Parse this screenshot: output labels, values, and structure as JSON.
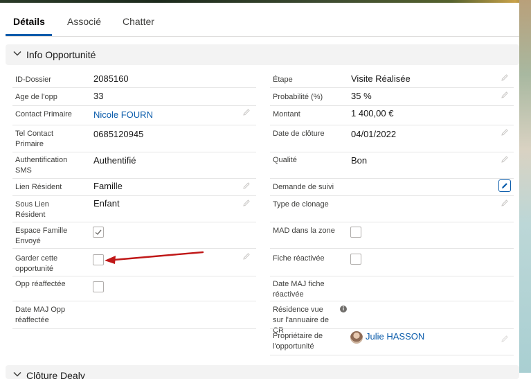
{
  "tabs": [
    {
      "label": "Détails",
      "active": true
    },
    {
      "label": "Associé"
    },
    {
      "label": "Chatter"
    }
  ],
  "section": {
    "title": "Info Opportunité"
  },
  "section2": {
    "title": "Clôture Dealy"
  },
  "left_fields": [
    {
      "label": "ID-Dossier",
      "value": "2085160"
    },
    {
      "label": "Age de l'opp",
      "value": "33"
    },
    {
      "label": "Contact Primaire",
      "value": "Nicole FOURN"
    },
    {
      "label": "Tel Contact Primaire",
      "value": "0685120945"
    },
    {
      "label": "Authentification SMS",
      "value": "Authentifié"
    },
    {
      "label": "Lien Résident",
      "value": "Famille"
    },
    {
      "label": "Sous Lien Résident",
      "value": "Enfant"
    },
    {
      "label": "Espace Famille Envoyé",
      "value": ""
    },
    {
      "label": "Garder cette opportunité",
      "value": ""
    },
    {
      "label": "Opp réaffectée",
      "value": ""
    },
    {
      "label": "Date MAJ Opp réaffectée",
      "value": ""
    }
  ],
  "right_fields": [
    {
      "label": "Étape",
      "value": "Visite Réalisée"
    },
    {
      "label": "Probabilité (%)",
      "value": "35 %"
    },
    {
      "label": "Montant",
      "value": "1 400,00 €"
    },
    {
      "label": "Date de clôture",
      "value": "04/01/2022"
    },
    {
      "label": "Qualité",
      "value": "Bon"
    },
    {
      "label": "Demande de suivi",
      "value": ""
    },
    {
      "label": "Type de clonage",
      "value": ""
    },
    {
      "label": "MAD dans la zone",
      "value": ""
    },
    {
      "label": "Fiche réactivée",
      "value": ""
    },
    {
      "label": "Date MAJ fiche réactivée",
      "value": ""
    },
    {
      "label": "Résidence vue sur l'annuaire de CR",
      "value": ""
    },
    {
      "label": "Propriétaire de l'opportunité",
      "value": "Julie HASSON"
    }
  ],
  "checkboxes": {
    "espace_famille_envoye": true,
    "garder_cette_opportunite": false,
    "opp_reaffectee": false,
    "mad_dans_la_zone": false,
    "fiche_reactivee": false
  },
  "colors": {
    "link": "#0b5cab",
    "annotation_arrow": "#c01818"
  }
}
